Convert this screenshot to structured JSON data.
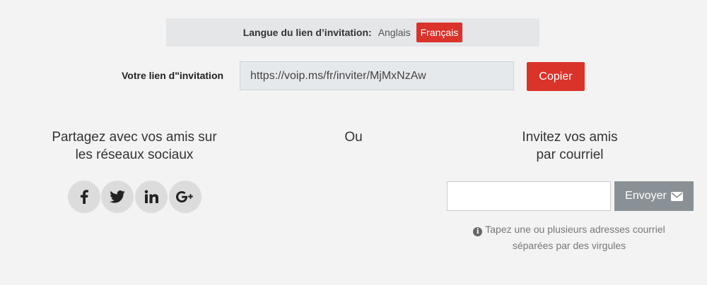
{
  "language": {
    "label": "Langue du lien d’invitation:",
    "options": [
      "Anglais",
      "Français"
    ],
    "selected": "Français"
  },
  "invite_link": {
    "label": "Votre lien d\"invitation",
    "value": "https://voip.ms/fr/inviter/MjMxNzAw",
    "copy_label": "Copier"
  },
  "share": {
    "title_line1": "Partagez avec vos amis sur",
    "title_line2": "les réseaux sociaux",
    "icons": [
      "facebook-icon",
      "twitter-icon",
      "linkedin-icon",
      "google-plus-icon"
    ]
  },
  "or_label": "Ou",
  "email_invite": {
    "title_line1": "Invitez vos amis",
    "title_line2": "par courriel",
    "input_value": "",
    "send_label": "Envoyer",
    "hint_line1": "Tapez une ou plusieurs adresses courriel",
    "hint_line2": "séparées par des virgules"
  },
  "colors": {
    "accent": "#d9332a",
    "send_button": "#8a9196",
    "lang_bar_bg": "#e4e6e8",
    "page_bg": "#f3f3f3"
  }
}
